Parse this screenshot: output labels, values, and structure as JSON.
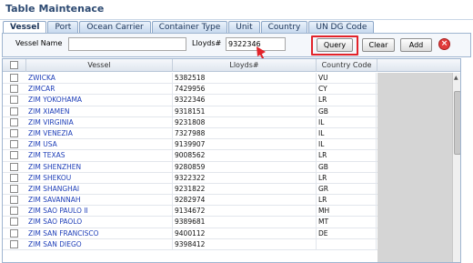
{
  "title": "Table Maintenace",
  "tabs": [
    {
      "label": "Vessel"
    },
    {
      "label": "Port"
    },
    {
      "label": "Ocean Carrier"
    },
    {
      "label": "Container Type"
    },
    {
      "label": "Unit"
    },
    {
      "label": "Country"
    },
    {
      "label": "UN DG Code"
    }
  ],
  "search": {
    "vessel_name_label": "Vessel Name",
    "vessel_name_value": "",
    "lloyds_label": "Lloyds#",
    "lloyds_value": "9322346",
    "query_label": "Query",
    "clear_label": "Clear",
    "add_label": "Add",
    "close_glyph": "×"
  },
  "grid": {
    "columns": {
      "vessel": "Vessel",
      "lloyds": "Lloyds#",
      "country": "Country Code"
    },
    "rows": [
      {
        "vessel": "ZWICKA",
        "lloyds": "5382518",
        "country": "VU"
      },
      {
        "vessel": "ZIMCAR",
        "lloyds": "7429956",
        "country": "CY"
      },
      {
        "vessel": "ZIM YOKOHAMA",
        "lloyds": "9322346",
        "country": "LR"
      },
      {
        "vessel": "ZIM XIAMEN",
        "lloyds": "9318151",
        "country": "GB"
      },
      {
        "vessel": "ZIM VIRGINIA",
        "lloyds": "9231808",
        "country": "IL"
      },
      {
        "vessel": "ZIM VENEZIA",
        "lloyds": "7327988",
        "country": "IL"
      },
      {
        "vessel": "ZIM USA",
        "lloyds": "9139907",
        "country": "IL"
      },
      {
        "vessel": "ZIM TEXAS",
        "lloyds": "9008562",
        "country": "LR"
      },
      {
        "vessel": "ZIM SHENZHEN",
        "lloyds": "9280859",
        "country": "GB"
      },
      {
        "vessel": "ZIM SHEKOU",
        "lloyds": "9322322",
        "country": "LR"
      },
      {
        "vessel": "ZIM SHANGHAI",
        "lloyds": "9231822",
        "country": "GR"
      },
      {
        "vessel": "ZIM SAVANNAH",
        "lloyds": "9282974",
        "country": "LR"
      },
      {
        "vessel": "ZIM SAO PAULO II",
        "lloyds": "9134672",
        "country": "MH"
      },
      {
        "vessel": "ZIM SAO PAOLO",
        "lloyds": "9389681",
        "country": "MT"
      },
      {
        "vessel": "ZIM SAN FRANCISCO",
        "lloyds": "9400112",
        "country": "DE"
      },
      {
        "vessel": "ZIM SAN DIEGO",
        "lloyds": "9398412",
        "country": ""
      }
    ]
  },
  "colors": {
    "accent": "#e2232a",
    "link": "#1f3fb8",
    "header": "#2d4a72"
  }
}
